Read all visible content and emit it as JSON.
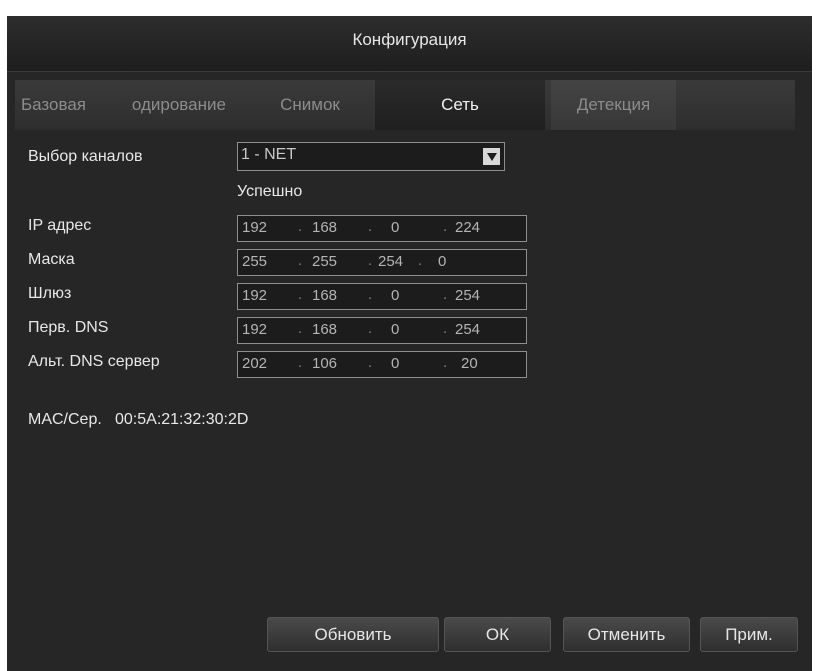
{
  "window": {
    "title": "Конфигурация"
  },
  "tabs": [
    {
      "label": "Базовая",
      "active": false
    },
    {
      "label": "Кодирование",
      "active": false
    },
    {
      "label": "Снимок",
      "active": false
    },
    {
      "label": "Сеть",
      "active": true
    },
    {
      "label": "Детекция",
      "active": false
    }
  ],
  "form": {
    "channel": {
      "label": "Выбор каналов",
      "value": "1 - NET"
    },
    "status": "Успешно",
    "ip": {
      "label": "IP адрес",
      "octets": [
        "192",
        "168",
        "0",
        "224"
      ]
    },
    "mask": {
      "label": "Маска",
      "octets": [
        "255",
        "255",
        "254",
        "0"
      ]
    },
    "gateway": {
      "label": "Шлюз",
      "octets": [
        "192",
        "168",
        "0",
        "254"
      ]
    },
    "dns1": {
      "label": "Перв. DNS",
      "octets": [
        "192",
        "168",
        "0",
        "254"
      ]
    },
    "dns2": {
      "label": "Альт. DNS сервер",
      "octets": [
        "202",
        "106",
        "0",
        "20"
      ]
    },
    "mac": {
      "label": "MAC/Сер.",
      "value": "00:5A:21:32:30:2D"
    }
  },
  "buttons": {
    "refresh": "Обновить",
    "ok": "ОК",
    "cancel": "Отменить",
    "apply": "Прим."
  }
}
